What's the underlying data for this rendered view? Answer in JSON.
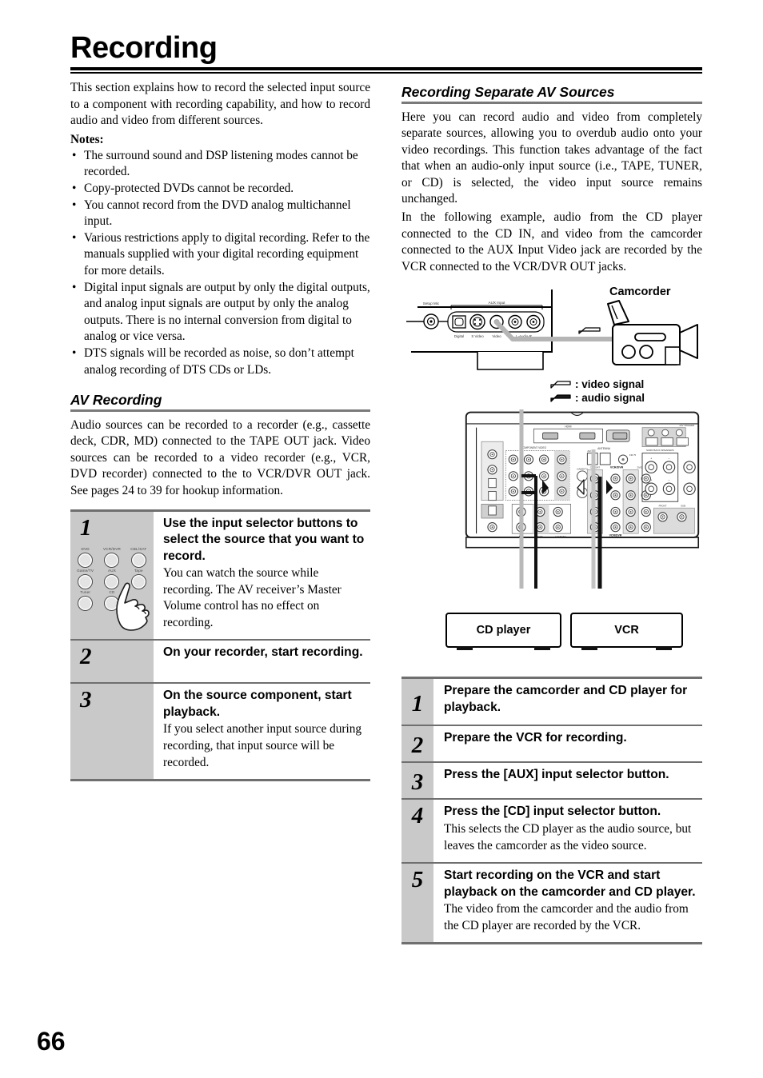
{
  "page": {
    "title": "Recording",
    "number": "66"
  },
  "left": {
    "intro": "This section explains how to record the selected input source to a component with recording capability, and how to record audio and video from different sources.",
    "notes_label": "Notes:",
    "notes": [
      "The surround sound and DSP listening modes cannot be recorded.",
      "Copy-protected DVDs cannot be recorded.",
      "You cannot record from the DVD analog multichannel input.",
      "Various restrictions apply to digital recording. Refer to the manuals supplied with your digital recording equipment for more details.",
      "Digital input signals are output by only the digital outputs, and analog input signals are output by only the analog outputs. There is no internal conversion from digital to analog or vice versa.",
      "DTS signals will be recorded as noise, so don’t attempt analog recording of DTS CDs or LDs."
    ],
    "subhead": "AV Recording",
    "av_text": "Audio sources can be recorded to a recorder (e.g., cassette deck, CDR, MD) connected to the TAPE OUT jack. Video sources can be recorded to a video recorder (e.g., VCR, DVD recorder) connected to the to VCR/DVR OUT jack. See pages 24 to 39 for hookup information.",
    "button_panel": {
      "labels": [
        "DVD",
        "VCR/DVR",
        "CBL/SAT",
        "Game/TV",
        "AUX",
        "Tape",
        "Tuner",
        "CD",
        ""
      ],
      "hand_icon": "pointing-hand-icon"
    },
    "steps": [
      {
        "num": "1",
        "title": "Use the input selector buttons to select the source that you want to record.",
        "text": "You can watch the source while recording. The AV receiver’s Master Volume control has no effect on recording."
      },
      {
        "num": "2",
        "title": "On your recorder, start recording.",
        "text": ""
      },
      {
        "num": "3",
        "title": "On the source component, start playback.",
        "text": "If you select another input source during recording, that input source will be recorded."
      }
    ]
  },
  "right": {
    "subhead": "Recording Separate AV Sources",
    "para1": "Here you can record audio and video from completely separate sources, allowing you to overdub audio onto your video recordings. This function takes advantage of the fact that when an audio-only input source (i.e., TAPE, TUNER, or CD) is selected, the video input source remains unchanged.",
    "para2": "In the following example, audio from the CD player connected to the CD IN, and video from the camcorder connected to the AUX Input Video jack are recorded by the VCR connected to the VCR/DVR OUT jacks.",
    "diagram": {
      "camcorder_label": "Camcorder",
      "front_panel": {
        "setup_mic": "Setup Mic",
        "aux_input": "AUX Input",
        "digital": "Digital",
        "s_video": "S Video",
        "video": "Video",
        "audio": "L-Audio-R"
      },
      "legend": [
        {
          "icon": "video-signal-arrow-icon",
          "label": ": video signal"
        },
        {
          "icon": "audio-signal-arrow-icon",
          "label": ": audio signal"
        }
      ],
      "rear_panel": {
        "hdmi": "HDMI",
        "component_video": "COMPONENT VIDEO",
        "antenna": "ANTENNA",
        "am": "AM",
        "fm": "FM 75Ω",
        "vcr_dvr": "VCR/DVR",
        "cd": "CD",
        "tape": "TAPE",
        "game_tv": "GAME/TV",
        "surr_back_speakers": "SURR BACK SPEAKERS",
        "front": "FRONT",
        "sub": "SUB",
        "center": "CENTER",
        "dvd": "DVD",
        "cbl_sat": "CBL/SAT"
      },
      "devices": [
        {
          "label": "CD player"
        },
        {
          "label": "VCR"
        }
      ]
    },
    "steps": [
      {
        "num": "1",
        "title": "Prepare the camcorder and CD player for playback.",
        "text": ""
      },
      {
        "num": "2",
        "title": "Prepare the VCR for recording.",
        "text": ""
      },
      {
        "num": "3",
        "title": "Press the [AUX] input selector button.",
        "text": ""
      },
      {
        "num": "4",
        "title": "Press the [CD] input selector button.",
        "text": "This selects the CD player as the audio source, but leaves the camcorder as the video source."
      },
      {
        "num": "5",
        "title": "Start recording on the VCR and start playback on the camcorder and CD player.",
        "text": "The video from the camcorder and the audio from the CD player are recorded by the VCR."
      }
    ]
  },
  "colors": {
    "rule": "#6f6f6f",
    "step_num_bg": "#c9c9c9",
    "text": "#000000"
  }
}
